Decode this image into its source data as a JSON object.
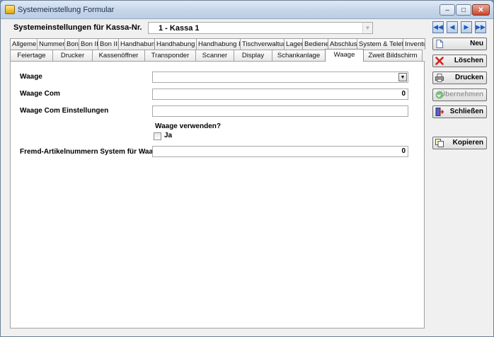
{
  "window": {
    "title": "Systemeinstellung Formular"
  },
  "header": {
    "label": "Systemeinstellungen für Kassa-Nr.",
    "kassa_value": "1 - Kassa 1"
  },
  "tabs_row1": [
    "Allgemein",
    "Nummern",
    "Bon",
    "Bon II",
    "Bon III",
    "Handhabung",
    "Handhabung II",
    "Handhabung III",
    "Tischverwaltung",
    "Lager",
    "Bediener",
    "Abschluss",
    "System & Telefon",
    "Inventur"
  ],
  "tabs_row2": [
    "Feiertage",
    "Drucker",
    "Kassenöffner",
    "Transponder",
    "Scanner",
    "Display",
    "Schankanlage",
    "Waage",
    "Zweit Bildschirm"
  ],
  "active_tab": "Waage",
  "form": {
    "waage_label": "Waage",
    "waage_value": "",
    "waage_com_label": "Waage Com",
    "waage_com_value": "0",
    "waage_com_einst_label": "Waage Com Einstellungen",
    "waage_com_einst_value": "",
    "waage_verwenden_label": "Waage verwenden?",
    "ja_label": "Ja",
    "ja_checked": false,
    "fremd_label": "Fremd-Artikelnummern System für Waage",
    "fremd_value": "0"
  },
  "side_buttons": {
    "neu": "Neu",
    "loeschen": "Löschen",
    "drucken": "Drucken",
    "uebernehmen": "Übernehmen",
    "schliessen": "Schließen",
    "kopieren": "Kopieren"
  },
  "icons": {
    "nav_first": "first-record-icon",
    "nav_prev": "previous-record-icon",
    "nav_next": "next-record-icon",
    "nav_last": "last-record-icon"
  },
  "colors": {
    "title_bar": "#c5d6ea",
    "nav_arrow": "#1e5bb8",
    "delete_red": "#d42020"
  }
}
